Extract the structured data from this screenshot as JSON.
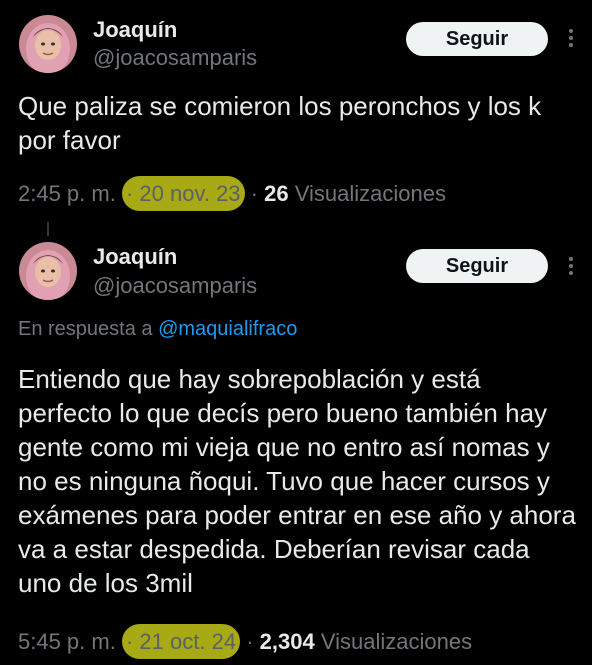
{
  "tweets": [
    {
      "author": {
        "name": "Joaquín",
        "handle": "@joacosamparis"
      },
      "follow_label": "Seguir",
      "text": "Que paliza se comieron los peronchos y los k por favor",
      "time": "2:45 p. m.",
      "date": "20 nov. 23",
      "views_count": "26",
      "views_label": "Visualizaciones"
    },
    {
      "author": {
        "name": "Joaquín",
        "handle": "@joacosamparis"
      },
      "follow_label": "Seguir",
      "reply_prefix": "En respuesta a",
      "reply_to": "@maquialifraco",
      "text": "Entiendo que hay sobrepoblación y está perfecto lo que decís pero bueno también hay gente como mi vieja que no entro así nomas y no es ninguna ñoqui. Tuvo que hacer cursos y exámenes para poder entrar en ese año y ahora va a estar despedida. Deberían revisar cada uno de los 3mil",
      "time": "5:45 p. m.",
      "date": "21 oct. 24",
      "views_count": "2,304",
      "views_label": "Visualizaciones"
    }
  ],
  "colors": {
    "background": "#000000",
    "text_primary": "#e7e9ea",
    "text_secondary": "#71767b",
    "link": "#1d9bf0",
    "highlight": "#a7a915",
    "follow_button": "#eff3f4"
  },
  "icons": [
    "avatar-icon",
    "more-options-icon"
  ]
}
